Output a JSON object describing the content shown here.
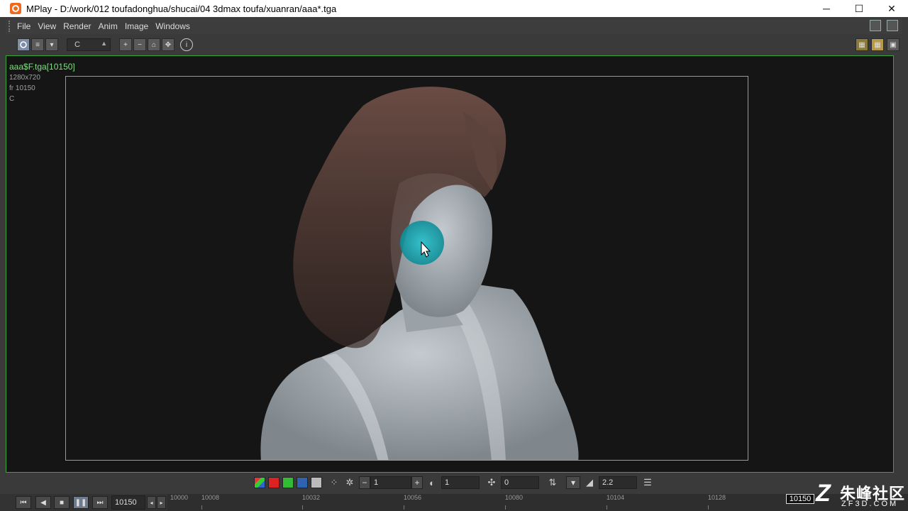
{
  "window": {
    "title": "MPlay - D:/work/012 toufadonghua/shucai/04 3dmax toufa/xuanran/aaa*.tga",
    "minimize": "─",
    "maximize": "☐",
    "close": "✕"
  },
  "menu": {
    "items": [
      "File",
      "View",
      "Render",
      "Anim",
      "Image",
      "Windows"
    ]
  },
  "toolbar": {
    "channel_value": "C",
    "info_label": "i"
  },
  "image_info": {
    "filename": "aaa$F.tga[10150]",
    "resolution": "1280x720",
    "frame": "fr 10150",
    "channel": "C"
  },
  "bottom_controls": {
    "exposure_value": "1",
    "contrast_value": "1",
    "offset_value": "0",
    "gamma_value": "2.2",
    "minus": "−",
    "plus": "+"
  },
  "playback": {
    "current_frame": "10150",
    "ticks": [
      "10000",
      "10008",
      "10032",
      "10056",
      "10080",
      "10104",
      "10128"
    ],
    "frame_marker": "10150"
  },
  "watermark": {
    "logo": "Z",
    "chinese": "朱峰社区",
    "english": "ZF3D.COM"
  },
  "colors": {
    "accent_green": "#3aa33a",
    "hair": "#5a4038",
    "skin": "#a6aeb4",
    "cursor_highlight": "#1aa6b0"
  }
}
